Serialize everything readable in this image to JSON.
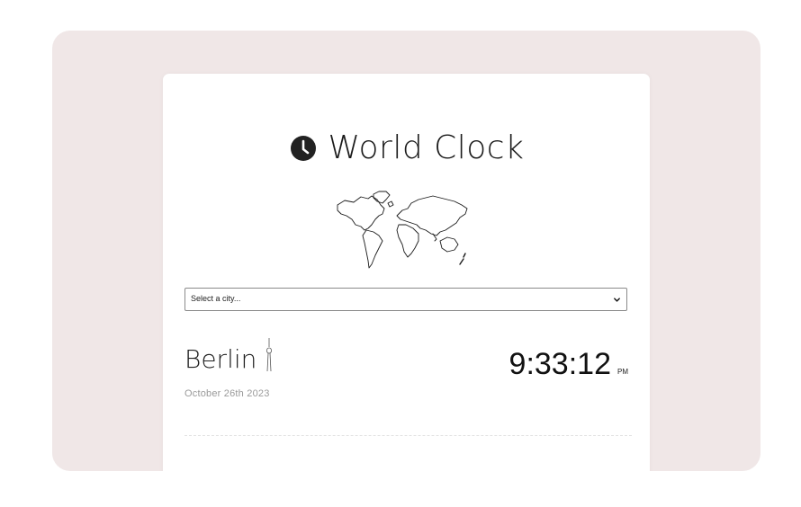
{
  "app": {
    "title": "World Clock"
  },
  "icons": {
    "title_icon": "clock-icon",
    "map": "world-map",
    "city_landmark": "tv-tower-icon",
    "select_arrow": "chevron-down-icon"
  },
  "city_select": {
    "value": "Select a city..."
  },
  "clock": {
    "city": "Berlin",
    "date": "October 26th 2023",
    "time": "9:33:12",
    "period": "PM"
  },
  "colors": {
    "frame_background": "#f0e7e7",
    "card_background": "#ffffff",
    "text_primary": "#111111",
    "text_muted": "#9a9a9a"
  }
}
